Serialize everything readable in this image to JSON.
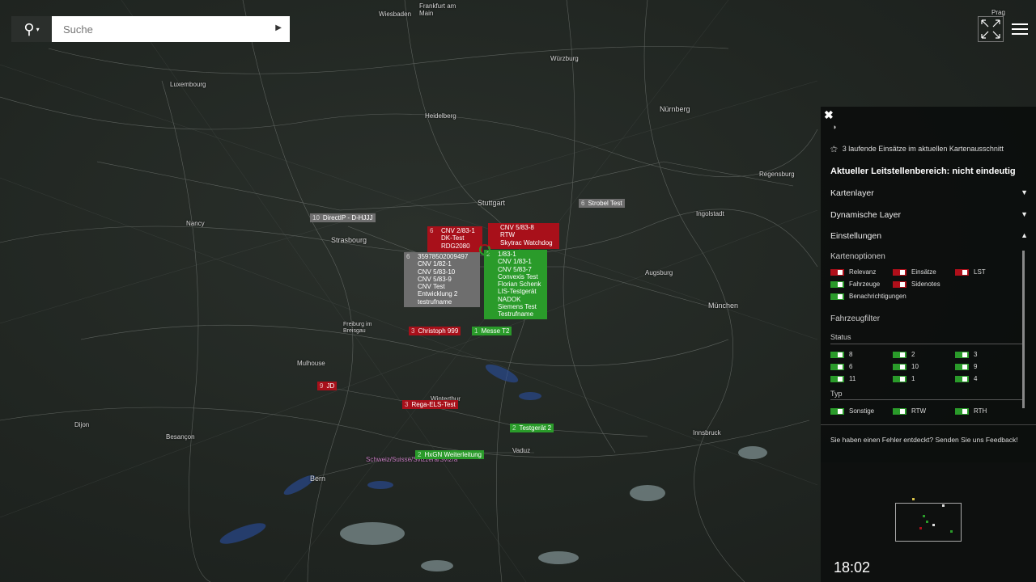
{
  "search": {
    "placeholder": "Suche",
    "go_icon": "play-arrow",
    "icon": "search-icon"
  },
  "map": {
    "cities": [
      {
        "name": "Wiesbaden"
      },
      {
        "name": "Frankfurt am Main"
      },
      {
        "name": "Prag"
      },
      {
        "name": "Luxembourg"
      },
      {
        "name": "Würzburg"
      },
      {
        "name": "Nürnberg"
      },
      {
        "name": "Heidelberg"
      },
      {
        "name": "Regensburg"
      },
      {
        "name": "Stuttgart"
      },
      {
        "name": "Nancy"
      },
      {
        "name": "Strasbourg"
      },
      {
        "name": "Ingolstadt"
      },
      {
        "name": "Augsburg"
      },
      {
        "name": "München"
      },
      {
        "name": "Freiburg im Breisgau"
      },
      {
        "name": "Mulhouse"
      },
      {
        "name": "Besançon"
      },
      {
        "name": "Winterthur"
      },
      {
        "name": "Vaduz"
      },
      {
        "name": "Bern"
      },
      {
        "name": "Innsbruck"
      },
      {
        "name": "Dijon"
      },
      {
        "name": "Schweiz/Suisse/Svizzera/Svizra"
      }
    ],
    "markers": {
      "direct_ip": {
        "num": "10",
        "text": "DirectIP - D-HJJJ"
      },
      "strobel": {
        "num": "6",
        "text": "Strobel Test"
      },
      "red_stack": {
        "num": "6",
        "lines": [
          "CNV 2/83-1",
          "DK-Test",
          "RDG2080"
        ]
      },
      "red_stack2": {
        "num": "",
        "lines": [
          "CNV 5/83-8",
          "RTW",
          "Skytrac Watchdog"
        ]
      },
      "grey_stack": {
        "num": "6",
        "lines": [
          "35978502009497",
          "CNV 1/82-1",
          "CNV 5/83-10",
          "CNV 5/83-9",
          "CNV Test",
          "Entwicklung 2",
          "testrufname"
        ]
      },
      "green_stack": {
        "num": "2",
        "lines": [
          "1/83-1",
          "CNV 1/83-1",
          "CNV 5/83-7",
          "Convexis Test",
          "Florian Schenk",
          "LIS-Testgerät",
          "NADOK",
          "Siemens Test",
          "Testrufname"
        ]
      },
      "christoph": {
        "num": "3",
        "text": "Christoph 999"
      },
      "messe": {
        "num": "1",
        "text": "Messe T2"
      },
      "jd": {
        "num": "9",
        "text": "JD"
      },
      "rega": {
        "num": "3",
        "text": "Rega-ELS-Test"
      },
      "testgeraet": {
        "num": "2",
        "text": "Testgerät 2"
      },
      "hxgn": {
        "num": "2",
        "text": "HxGN Weiterleitung"
      }
    }
  },
  "panel": {
    "info": "3 laufende Einsätze im aktuellen Kartenausschnitt",
    "leitstelle": "Aktueller Leitstellenbereich: nicht eindeutig",
    "acc_kartenlayer": "Kartenlayer",
    "acc_dynamisch": "Dynamische Layer",
    "acc_einstellungen": "Einstellungen",
    "kartenoptionen_title": "Kartenoptionen",
    "kartenoptionen": [
      "Relevanz",
      "Einsätze",
      "LST",
      "Fahrzeuge",
      "Sidenotes",
      "Benachrichtigungen"
    ],
    "fahrzeugfilter_title": "Fahrzeugfilter",
    "status_title": "Status",
    "status": [
      "8",
      "2",
      "3",
      "6",
      "10",
      "9",
      "11",
      "1",
      "4"
    ],
    "typ_title": "Typ",
    "typ": [
      "Sonstige",
      "RTW",
      "RTH"
    ],
    "feedback": "Sie haben einen Fehler entdeckt? Senden Sie uns Feedback!",
    "time": "18:02"
  },
  "colors": {
    "red": "#a8101a",
    "green": "#2a9b2a",
    "grey": "#6e6e6e"
  }
}
